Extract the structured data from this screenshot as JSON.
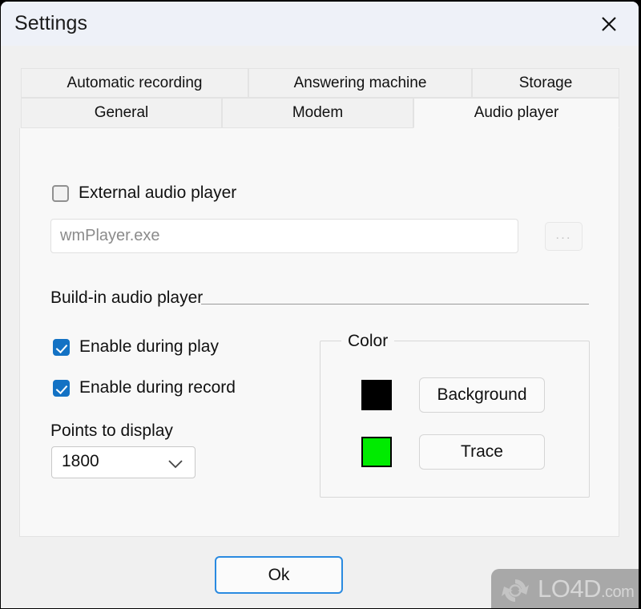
{
  "window": {
    "title": "Settings",
    "close_icon": "close-icon"
  },
  "tabs": {
    "row1": [
      {
        "label": "Automatic recording",
        "selected": false
      },
      {
        "label": "Answering machine",
        "selected": false
      },
      {
        "label": "Storage",
        "selected": false
      }
    ],
    "row2": [
      {
        "label": "General",
        "selected": false
      },
      {
        "label": "Modem",
        "selected": false
      },
      {
        "label": "Audio player",
        "selected": true
      }
    ]
  },
  "audio_player": {
    "external": {
      "checkbox_label": "External audio player",
      "checked": false,
      "path_value": "wmPlayer.exe",
      "browse_label": "...",
      "browse_icon": "ellipsis-icon"
    },
    "buildin": {
      "section_label": "Build-in audio player",
      "enable_play": {
        "label": "Enable during play",
        "checked": true
      },
      "enable_record": {
        "label": "Enable during record",
        "checked": true
      },
      "points_label": "Points to display",
      "points_value": "1800",
      "points_options": [
        "1800"
      ],
      "chevron_icon": "chevron-down-icon"
    },
    "color": {
      "group_title": "Color",
      "background": {
        "button_label": "Background",
        "swatch_color": "#000000"
      },
      "trace": {
        "button_label": "Trace",
        "swatch_color": "#00eb00"
      }
    }
  },
  "footer": {
    "ok_label": "Ok"
  },
  "watermark": {
    "brand": "LO4D",
    "suffix": ".com",
    "logo_icon": "recycle-arrows-icon"
  },
  "theme": {
    "accent": "#1372c4",
    "focus_border": "#2a8ae0",
    "titlebar_bg": "#eef1f8",
    "panel_bg": "#f8f8f8",
    "window_bg": "#f0f0f0"
  }
}
